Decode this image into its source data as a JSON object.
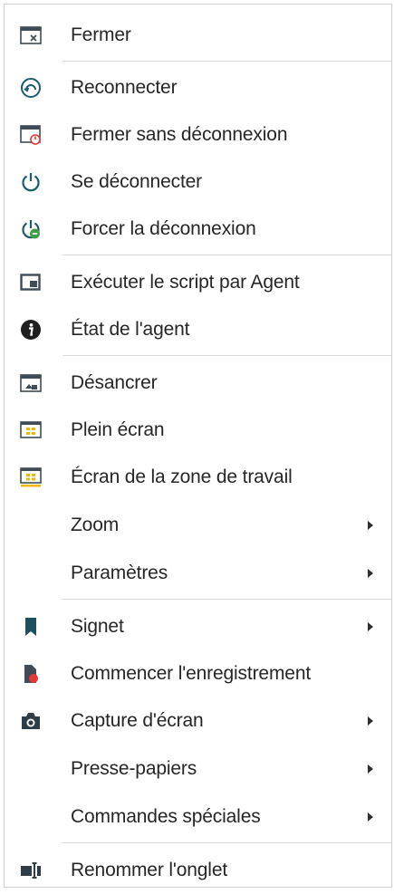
{
  "menu": {
    "items": [
      {
        "label": "Fermer",
        "icon": "close-window-icon",
        "submenu": false
      },
      {
        "label": "Reconnecter",
        "icon": "reconnect-icon",
        "submenu": false
      },
      {
        "label": "Fermer sans déconnexion",
        "icon": "close-without-disconnect-icon",
        "submenu": false
      },
      {
        "label": "Se déconnecter",
        "icon": "power-icon",
        "submenu": false
      },
      {
        "label": "Forcer la déconnexion",
        "icon": "force-disconnect-icon",
        "submenu": false
      },
      {
        "label": "Exécuter le script par Agent",
        "icon": "agent-script-icon",
        "submenu": false
      },
      {
        "label": "État de l'agent",
        "icon": "info-icon",
        "submenu": false
      },
      {
        "label": "Désancrer",
        "icon": "undock-icon",
        "submenu": false
      },
      {
        "label": "Plein écran",
        "icon": "fullscreen-icon",
        "submenu": false
      },
      {
        "label": "Écran de la zone de travail",
        "icon": "workspace-screen-icon",
        "submenu": false
      },
      {
        "label": "Zoom",
        "icon": "",
        "submenu": true
      },
      {
        "label": "Paramètres",
        "icon": "",
        "submenu": true
      },
      {
        "label": "Signet",
        "icon": "bookmark-icon",
        "submenu": true
      },
      {
        "label": "Commencer l'enregistrement",
        "icon": "record-icon",
        "submenu": false
      },
      {
        "label": "Capture d'écran",
        "icon": "camera-icon",
        "submenu": true
      },
      {
        "label": "Presse-papiers",
        "icon": "",
        "submenu": true
      },
      {
        "label": "Commandes spéciales",
        "icon": "",
        "submenu": true
      },
      {
        "label": "Renommer l'onglet",
        "icon": "rename-tab-icon",
        "submenu": false
      }
    ]
  },
  "colors": {
    "text": "#262626",
    "icon_dark": "#4a4a4a",
    "icon_teal": "#1d5d6b",
    "accent_red": "#e53935",
    "accent_green": "#43a047",
    "accent_yellow": "#f2b705"
  }
}
